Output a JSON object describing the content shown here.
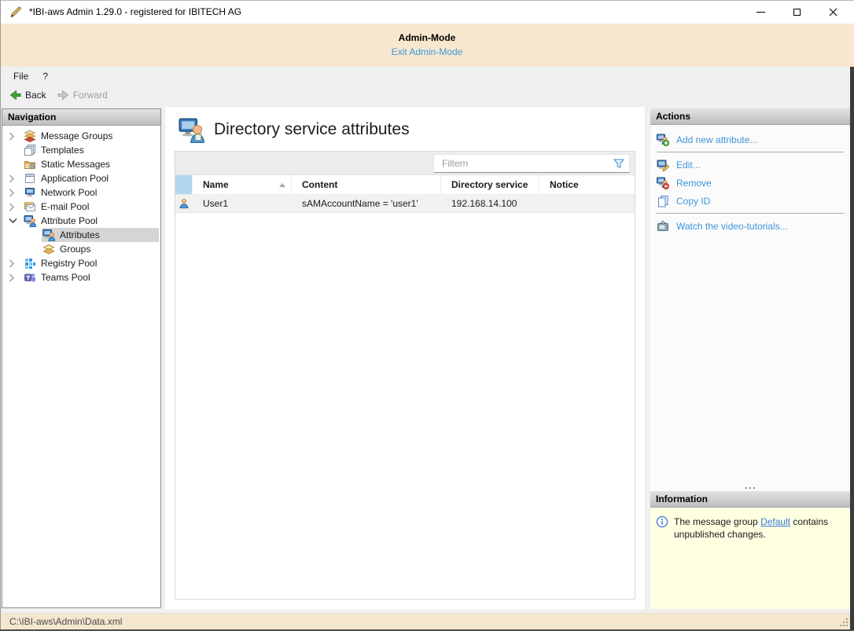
{
  "window": {
    "title": "*IBI-aws Admin 1.29.0 - registered for IBITECH AG"
  },
  "banner": {
    "title": "Admin-Mode",
    "exit_link": "Exit Admin-Mode"
  },
  "menubar": {
    "items": [
      "File",
      "?"
    ]
  },
  "toolbar": {
    "back_label": "Back",
    "forward_label": "Forward",
    "forward_disabled": true
  },
  "sidebar": {
    "title": "Navigation",
    "items": [
      {
        "label": "Message Groups",
        "icon": "message-groups-icon",
        "expander": "collapsed",
        "level": 0,
        "selected": false
      },
      {
        "label": "Templates",
        "icon": "templates-icon",
        "expander": "none",
        "level": 0,
        "selected": false
      },
      {
        "label": "Static Messages",
        "icon": "static-messages-icon",
        "expander": "none",
        "level": 0,
        "selected": false
      },
      {
        "label": "Application Pool",
        "icon": "application-pool-icon",
        "expander": "collapsed",
        "level": 0,
        "selected": false
      },
      {
        "label": "Network Pool",
        "icon": "network-pool-icon",
        "expander": "collapsed",
        "level": 0,
        "selected": false
      },
      {
        "label": "E-mail Pool",
        "icon": "email-pool-icon",
        "expander": "collapsed",
        "level": 0,
        "selected": false
      },
      {
        "label": "Attribute Pool",
        "icon": "attribute-pool-icon",
        "expander": "expanded",
        "level": 0,
        "selected": false
      },
      {
        "label": "Attributes",
        "icon": "attributes-icon",
        "expander": "none",
        "level": 1,
        "selected": true
      },
      {
        "label": "Groups",
        "icon": "groups-icon",
        "expander": "none",
        "level": 1,
        "selected": false
      },
      {
        "label": "Registry Pool",
        "icon": "registry-pool-icon",
        "expander": "collapsed",
        "level": 0,
        "selected": false
      },
      {
        "label": "Teams Pool",
        "icon": "teams-pool-icon",
        "expander": "collapsed",
        "level": 0,
        "selected": false
      }
    ]
  },
  "main": {
    "title": "Directory service attributes",
    "table": {
      "filter_placeholder": "Filtern",
      "columns": [
        "Name",
        "Content",
        "Directory service",
        "Notice"
      ],
      "sort": {
        "column": "Name",
        "direction": "ascending"
      },
      "rows": [
        {
          "name": "User1",
          "content": "sAMAccountName = 'user1'",
          "directory_service": "192.168.14.100",
          "notice": ""
        }
      ]
    }
  },
  "actions": {
    "title": "Actions",
    "items": [
      {
        "label": "Add new attribute...",
        "icon": "add-attribute-icon"
      },
      {
        "label": "Edit...",
        "icon": "edit-icon"
      },
      {
        "label": "Remove",
        "icon": "remove-icon"
      },
      {
        "label": "Copy ID",
        "icon": "copy-id-icon"
      },
      {
        "label": "Watch the video-tutorials...",
        "icon": "video-tutorials-icon"
      }
    ]
  },
  "information": {
    "title": "Information",
    "message_prefix": "The message group ",
    "link_label": "Default",
    "message_suffix": " contains unpublished changes."
  },
  "statusbar": {
    "path": "C:\\IBI-aws\\Admin\\Data.xml"
  },
  "icons": {
    "app-icon": "gold-pen",
    "minimize-icon": "–",
    "maximize-icon": "□",
    "close-icon": "✕",
    "back-icon": "green-arrow-left",
    "forward-icon": "gray-arrow-right",
    "chevron-right-icon": "›",
    "chevron-down-icon": "⌄",
    "filter-funnel-icon": "blue-funnel",
    "sort-asc-icon": "▲",
    "user-icon": "person",
    "info-icon": "blue-circle-i",
    "directory-service-icon": "monitor-person"
  },
  "colors": {
    "banner_bg": "#f8e7cf",
    "status_bg": "#f4e6cf",
    "chrome_bg": "#f0f0f0",
    "link_blue": "#3d95da",
    "info_bg": "#ffffe1",
    "grid_indicator_blue": "#b5d7ee",
    "tree_selected_bg": "#d5d5d5",
    "row_bg": "#f1f1f1"
  }
}
